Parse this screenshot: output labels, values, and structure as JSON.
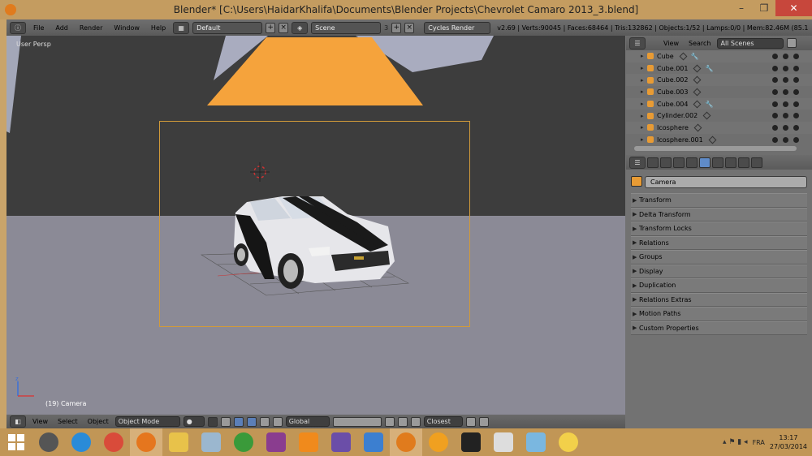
{
  "window": {
    "title": "Blender* [C:\\Users\\HaidarKhalifa\\Documents\\Blender Projects\\Chevrolet Camaro 2013_3.blend]"
  },
  "info_header": {
    "menus": [
      "File",
      "Add",
      "Render",
      "Window",
      "Help"
    ],
    "layout": "Default",
    "scene": "Scene",
    "scene_users": "3",
    "render_engine": "Cycles Render",
    "stats": "v2.69 | Verts:90045 | Faces:68464 | Tris:132862 | Objects:1/52 | Lamps:0/0 | Mem:82.46M (85.1"
  },
  "viewport": {
    "view_name": "User Persp",
    "active_object": "(19) Camera",
    "header": {
      "menus": [
        "View",
        "Select",
        "Object"
      ],
      "mode": "Object Mode",
      "orientation": "Global",
      "snap": "Closest"
    }
  },
  "outliner": {
    "menus": [
      "View",
      "Search"
    ],
    "filter": "All Scenes",
    "items": [
      {
        "name": "Cube",
        "has_modifier": true
      },
      {
        "name": "Cube.001",
        "has_modifier": true
      },
      {
        "name": "Cube.002",
        "has_modifier": false
      },
      {
        "name": "Cube.003",
        "has_modifier": false
      },
      {
        "name": "Cube.004",
        "has_modifier": true
      },
      {
        "name": "Cylinder.002",
        "has_modifier": false
      },
      {
        "name": "Icosphere",
        "has_modifier": false
      },
      {
        "name": "Icosphere.001",
        "has_modifier": false
      }
    ]
  },
  "properties": {
    "object_name": "Camera",
    "panels": [
      "Transform",
      "Delta Transform",
      "Transform Locks",
      "Relations",
      "Groups",
      "Display",
      "Duplication",
      "Relations Extras",
      "Motion Paths",
      "Custom Properties"
    ]
  },
  "taskbar": {
    "language": "FRA",
    "time": "13:17",
    "date": "27/03/2014"
  },
  "colors": {
    "taskbar": "#c19656",
    "lamp": "#f5a33c",
    "camera_frame": "#d19a3a",
    "active_context": "#5f8bc8"
  }
}
